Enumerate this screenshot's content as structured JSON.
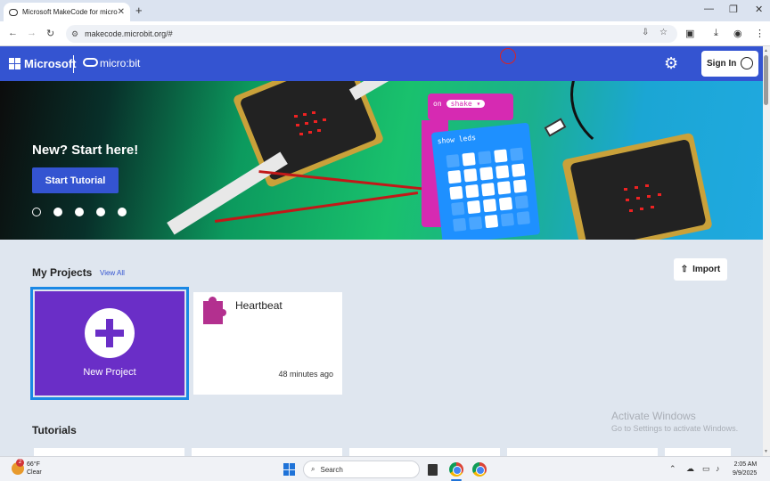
{
  "browser": {
    "tab_title": "Microsoft MakeCode for micro:bit",
    "tab_close": "✕",
    "new_tab": "+",
    "url": "makecode.microbit.org/#",
    "controls": {
      "minimize": "—",
      "restore": "❐",
      "close": "✕"
    }
  },
  "header": {
    "brand": "Microsoft",
    "product": "micro:bit",
    "sign_in": "Sign In"
  },
  "hero": {
    "title": "New? Start here!",
    "button": "Start Tutorial",
    "slides": 5,
    "active_slide": 1,
    "block_on": "on",
    "block_event": "shake ▾",
    "block_show": "show leds"
  },
  "projects": {
    "heading": "My Projects",
    "view_all": "View All",
    "import": "Import",
    "new_project": "New Project",
    "items": [
      {
        "name": "Heartbeat",
        "time": "48 minutes ago"
      }
    ]
  },
  "tutorials": {
    "heading": "Tutorials"
  },
  "watermark": {
    "line1": "Activate Windows",
    "line2": "Go to Settings to activate Windows."
  },
  "taskbar": {
    "weather_temp": "66°F",
    "weather_desc": "Clear",
    "notification_count": "2",
    "search_placeholder": "Search",
    "time": "2:05 AM",
    "date": "9/9/2025"
  },
  "colors": {
    "accent": "#3454d1",
    "new_project": "#6a2ec7",
    "selection": "#1a88e5",
    "block_pink": "#d62ab2",
    "block_blue": "#1e90ff"
  }
}
